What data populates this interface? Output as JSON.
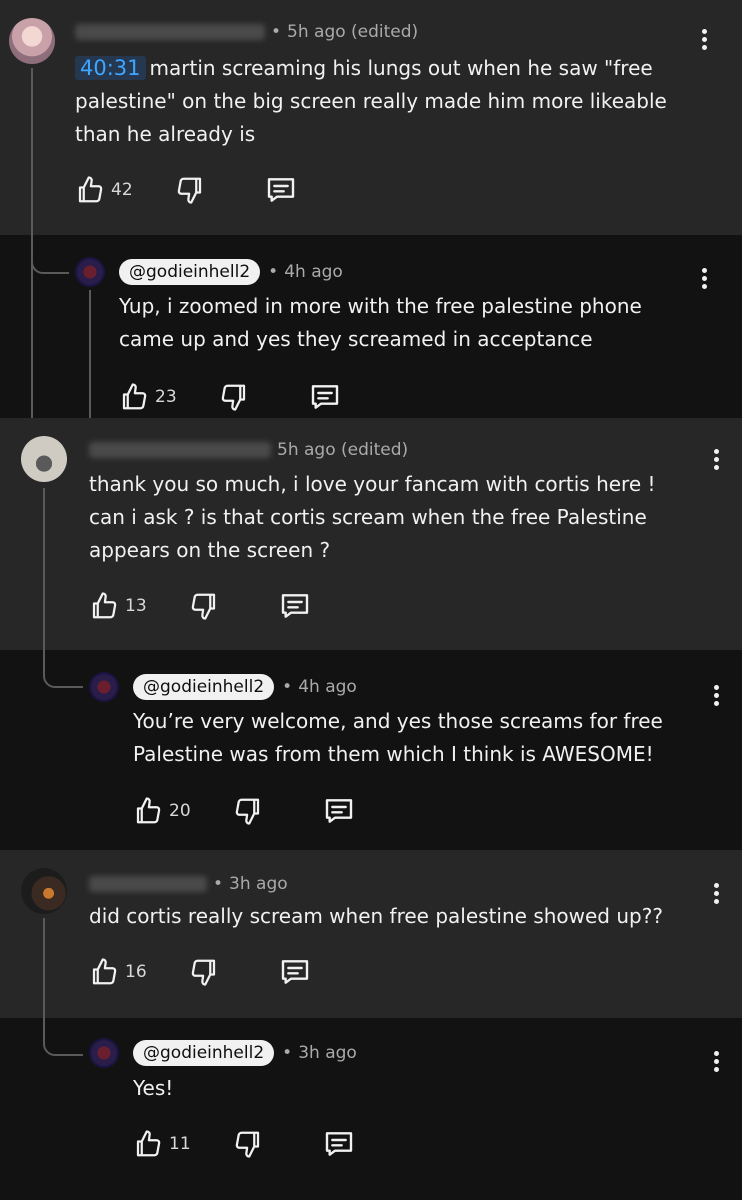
{
  "comments": [
    {
      "author": "",
      "time": "5h ago (edited)",
      "timestamp": "40:31",
      "text": "martin screaming his lungs out when he saw \"free palestine\" on the big screen really made him more likeable than he already is",
      "likes": "42",
      "reply": {
        "handle": "@godieinhell2",
        "time": "4h ago",
        "text": "Yup, i zoomed in more with the free palestine phone came up and yes they screamed in acceptance",
        "likes": "23"
      }
    },
    {
      "author": "",
      "time": "5h ago (edited)",
      "text": "thank you so much, i love your fancam with cortis here ! can i ask ? is that cortis scream when the free Palestine appears on the screen ?",
      "likes": "13",
      "reply": {
        "handle": "@godieinhell2",
        "time": "4h ago",
        "text": "You’re very welcome, and yes those screams for free Palestine was from them which I think is AWESOME!",
        "likes": "20"
      }
    },
    {
      "author": "",
      "time": "3h ago",
      "text": "did cortis really scream when free palestine showed up??",
      "likes": "16",
      "reply": {
        "handle": "@godieinhell2",
        "time": "3h ago",
        "text": "Yes!",
        "likes": "11"
      }
    }
  ],
  "icons": {
    "like": "thumbs-up-icon",
    "dislike": "thumbs-down-icon",
    "reply": "comment-icon",
    "more": "more-vert-icon"
  },
  "colors": {
    "top_bg": "#272727",
    "reply_bg": "#121212",
    "timestamp_link": "#3ea6ff"
  }
}
